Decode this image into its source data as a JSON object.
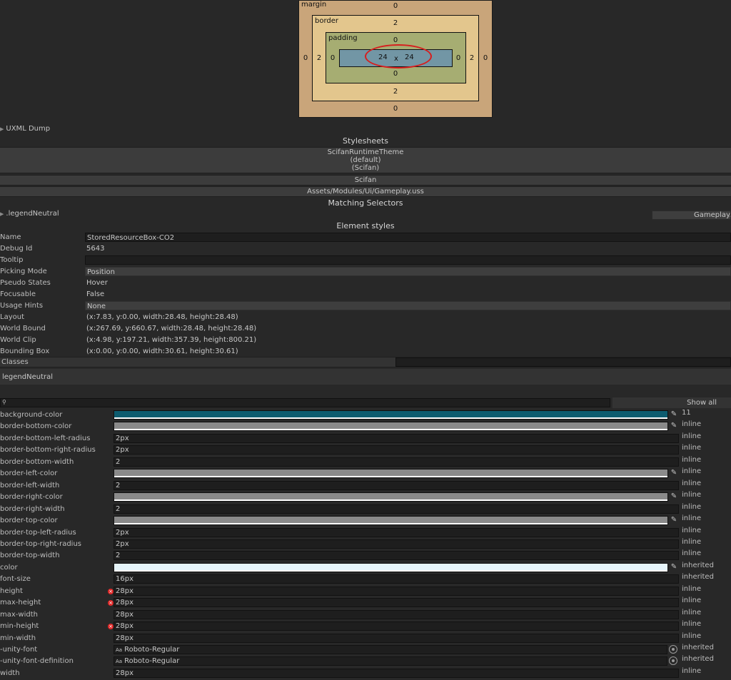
{
  "box_model": {
    "margin_label": "margin",
    "border_label": "border",
    "padding_label": "padding",
    "margin": {
      "top": "0",
      "left": "0",
      "right": "0",
      "bottom": "0"
    },
    "border": {
      "top": "2",
      "left": "2",
      "right": "2",
      "bottom": "2"
    },
    "padding": {
      "top": "0",
      "left": "0",
      "right": "0",
      "bottom": "0"
    },
    "content": {
      "width": "24",
      "x": "x",
      "height": "24"
    }
  },
  "uxml_dump": "UXML Dump",
  "stylesheets": {
    "title": "Stylesheets",
    "items": [
      {
        "line1": "ScifanRuntimeTheme",
        "line2": "(default)",
        "line3": "(Scifan)"
      },
      {
        "line1": "Scifan"
      },
      {
        "line1": "Assets/Modules/Ui/Gameplay.uss"
      }
    ]
  },
  "matching_selectors": {
    "title": "Matching Selectors",
    "selector": ".legendNeutral",
    "file_button": "Gameplay.u"
  },
  "element_styles_title": "Element styles",
  "properties": [
    {
      "label": "Name",
      "value": "StoredResourceBox-CO2",
      "kind": "dark"
    },
    {
      "label": "Debug Id",
      "value": "5643",
      "kind": "plain"
    },
    {
      "label": "Tooltip",
      "value": "",
      "kind": "dark"
    },
    {
      "label": "Picking Mode",
      "value": "Position",
      "kind": "drop"
    },
    {
      "label": "Pseudo States",
      "value": "Hover",
      "kind": "plain"
    },
    {
      "label": "Focusable",
      "value": "False",
      "kind": "plain"
    },
    {
      "label": "Usage Hints",
      "value": "None",
      "kind": "drop"
    },
    {
      "label": "Layout",
      "value": "(x:7.83, y:0.00, width:28.48, height:28.48)",
      "kind": "plain"
    },
    {
      "label": "World Bound",
      "value": "(x:267.69, y:660.67, width:28.48, height:28.48)",
      "kind": "plain"
    },
    {
      "label": "World Clip",
      "value": "(x:4.98, y:197.21, width:357.39, height:800.21)",
      "kind": "plain"
    },
    {
      "label": "Bounding Box",
      "value": "(x:0.00, y:0.00, width:30.61, height:30.61)",
      "kind": "plain"
    }
  ],
  "classes": {
    "label": "Classes",
    "item": "legendNeutral"
  },
  "search": {
    "icon": "search-icon",
    "placeholder": "",
    "show_all": "Show all"
  },
  "styles": [
    {
      "name": "background-color",
      "type": "color",
      "color": "#0d5c6f",
      "source": "11"
    },
    {
      "name": "border-bottom-color",
      "type": "color",
      "color": "#8a8a8a",
      "source": "inline"
    },
    {
      "name": "border-bottom-left-radius",
      "type": "text",
      "value": "2px",
      "source": "inline"
    },
    {
      "name": "border-bottom-right-radius",
      "type": "text",
      "value": "2px",
      "source": "inline"
    },
    {
      "name": "border-bottom-width",
      "type": "text",
      "value": "2",
      "source": "inline"
    },
    {
      "name": "border-left-color",
      "type": "color",
      "color": "#8a8a8a",
      "source": "inline"
    },
    {
      "name": "border-left-width",
      "type": "text",
      "value": "2",
      "source": "inline"
    },
    {
      "name": "border-right-color",
      "type": "color",
      "color": "#8a8a8a",
      "source": "inline"
    },
    {
      "name": "border-right-width",
      "type": "text",
      "value": "2",
      "source": "inline"
    },
    {
      "name": "border-top-color",
      "type": "color",
      "color": "#8a8a8a",
      "source": "inline"
    },
    {
      "name": "border-top-left-radius",
      "type": "text",
      "value": "2px",
      "source": "inline"
    },
    {
      "name": "border-top-right-radius",
      "type": "text",
      "value": "2px",
      "source": "inline"
    },
    {
      "name": "border-top-width",
      "type": "text",
      "value": "2",
      "source": "inline"
    },
    {
      "name": "color",
      "type": "color",
      "color": "#e6f5fb",
      "source": "inherited"
    },
    {
      "name": "font-size",
      "type": "text",
      "value": "16px",
      "source": "inherited"
    },
    {
      "name": "height",
      "type": "text",
      "value": "28px",
      "source": "inline",
      "error": true
    },
    {
      "name": "max-height",
      "type": "text",
      "value": "28px",
      "source": "inline",
      "error": true
    },
    {
      "name": "max-width",
      "type": "text",
      "value": "28px",
      "source": "inline"
    },
    {
      "name": "min-height",
      "type": "text",
      "value": "28px",
      "source": "inline",
      "error": true
    },
    {
      "name": "min-width",
      "type": "text",
      "value": "28px",
      "source": "inline"
    },
    {
      "name": "-unity-font",
      "type": "font",
      "value": "Roboto-Regular",
      "prefix": "Aa",
      "source": "inherited"
    },
    {
      "name": "-unity-font-definition",
      "type": "font",
      "value": "Roboto-Regular",
      "prefix": "Aa",
      "source": "inherited"
    },
    {
      "name": "width",
      "type": "text",
      "value": "28px",
      "source": "inline"
    }
  ]
}
